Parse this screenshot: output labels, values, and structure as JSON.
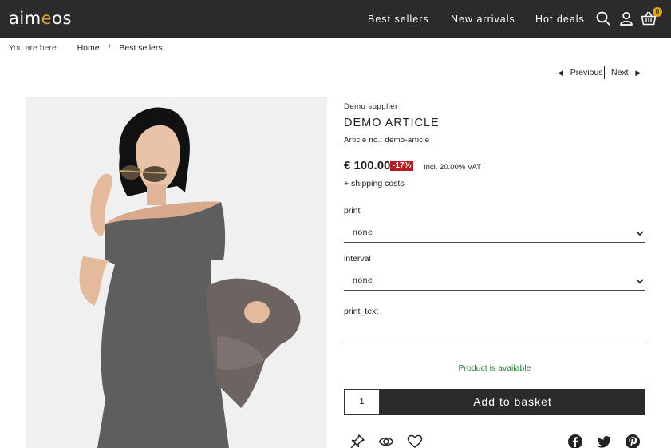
{
  "header": {
    "logo": {
      "part1": "aim",
      "accent": "e",
      "part2": "os"
    },
    "nav": [
      "Best sellers",
      "New arrivals",
      "Hot deals"
    ],
    "icons": [
      "search-icon",
      "user-icon",
      "basket-icon"
    ],
    "basket_count": "0"
  },
  "breadcrumb": {
    "label": "You are here:",
    "items": [
      "Home",
      "Best sellers"
    ],
    "separator": "/"
  },
  "pager": {
    "previous": "Previous",
    "next": "Next"
  },
  "product": {
    "supplier": "Demo supplier",
    "title": "DEMO ARTICLE",
    "article_no": "Article no.: demo-article",
    "price": "€ 100.00",
    "discount": "-17%",
    "vat": "Incl. 20.00% VAT",
    "shipping": "+ shipping costs",
    "stock": "Product is available"
  },
  "options": {
    "print": {
      "label": "print",
      "value": "none"
    },
    "interval": {
      "label": "interval",
      "value": "none"
    },
    "print_text": {
      "label": "print_text",
      "value": ""
    }
  },
  "basket": {
    "quantity": "1",
    "add_label": "Add to basket"
  },
  "actions": [
    "pin-icon",
    "watch-eye-icon",
    "favorite-heart-icon"
  ],
  "share": [
    "facebook-icon",
    "twitter-icon",
    "pinterest-icon"
  ],
  "colors": {
    "header_bg": "#2b2b2b",
    "accent": "#d9a23a",
    "discount_bg": "#b01e1e",
    "stock_green": "#2e7d32",
    "button_bg": "#2b2b2b"
  }
}
